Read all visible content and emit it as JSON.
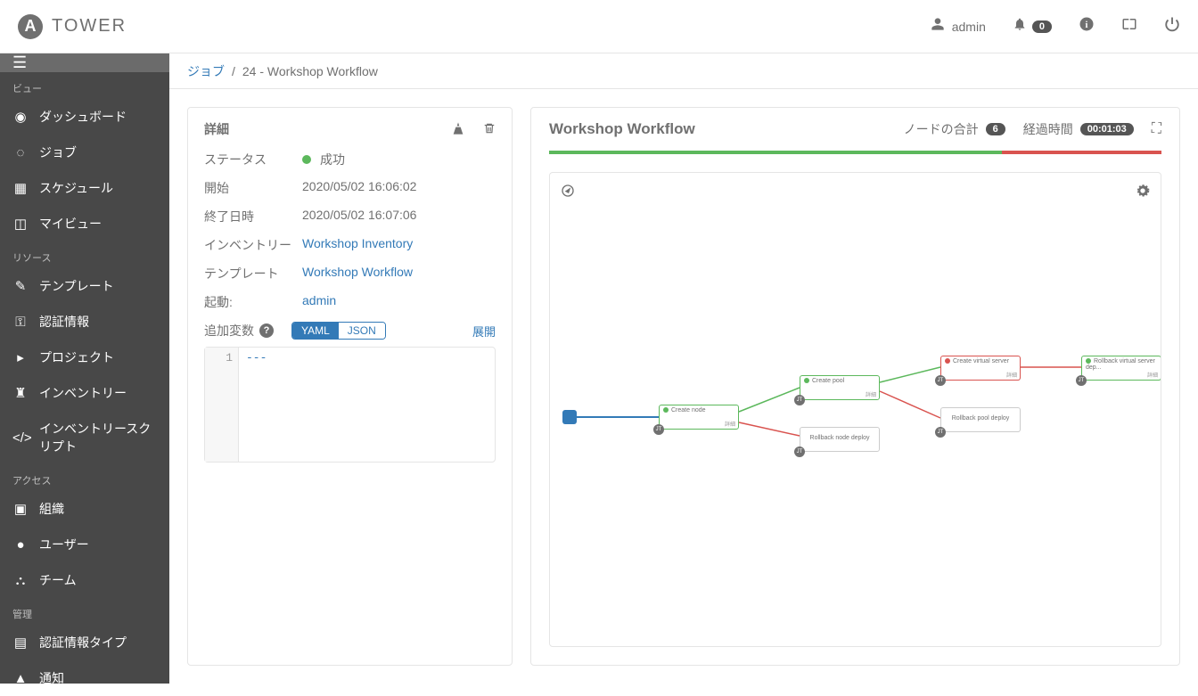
{
  "brand": "TOWER",
  "header": {
    "user": "admin",
    "notification_count": "0"
  },
  "breadcrumb": {
    "jobs": "ジョブ",
    "current": "24 - Workshop Workflow"
  },
  "sidebar": {
    "view_heading": "ビュー",
    "resource_heading": "リソース",
    "access_heading": "アクセス",
    "admin_heading": "管理",
    "dashboard": "ダッシュボード",
    "jobs": "ジョブ",
    "schedules": "スケジュール",
    "myview": "マイビュー",
    "templates": "テンプレート",
    "credentials": "認証情報",
    "projects": "プロジェクト",
    "inventories": "インベントリー",
    "inventory_scripts": "インベントリースクリプト",
    "organizations": "組織",
    "users": "ユーザー",
    "teams": "チーム",
    "credential_types": "認証情報タイプ",
    "notifications": "通知"
  },
  "details": {
    "title": "詳細",
    "status_label": "ステータス",
    "status_value": "成功",
    "start_label": "開始",
    "start_value": "2020/05/02 16:06:02",
    "end_label": "終了日時",
    "end_value": "2020/05/02 16:07:06",
    "inventory_label": "インベントリー",
    "inventory_value": "Workshop Inventory",
    "template_label": "テンプレート",
    "template_value": "Workshop Workflow",
    "launched_label": "起動:",
    "launched_value": "admin",
    "extra_vars_label": "追加変数",
    "yaml": "YAML",
    "json": "JSON",
    "expand": "展開",
    "line_no": "1",
    "code": "---"
  },
  "workflow": {
    "title": "Workshop Workflow",
    "total_label": "ノードの合計",
    "total_count": "6",
    "elapsed_label": "経過時間",
    "elapsed_value": "00:01:03",
    "detail_text": "詳細",
    "jt_badge": "JT",
    "nodes": {
      "create_node": "Create node",
      "create_pool": "Create pool",
      "rollback_node": "Rollback node deploy",
      "create_vs": "Create virtual server",
      "rollback_pool": "Rollback pool deploy",
      "rollback_vs": "Rollback virtual server dep..."
    }
  }
}
